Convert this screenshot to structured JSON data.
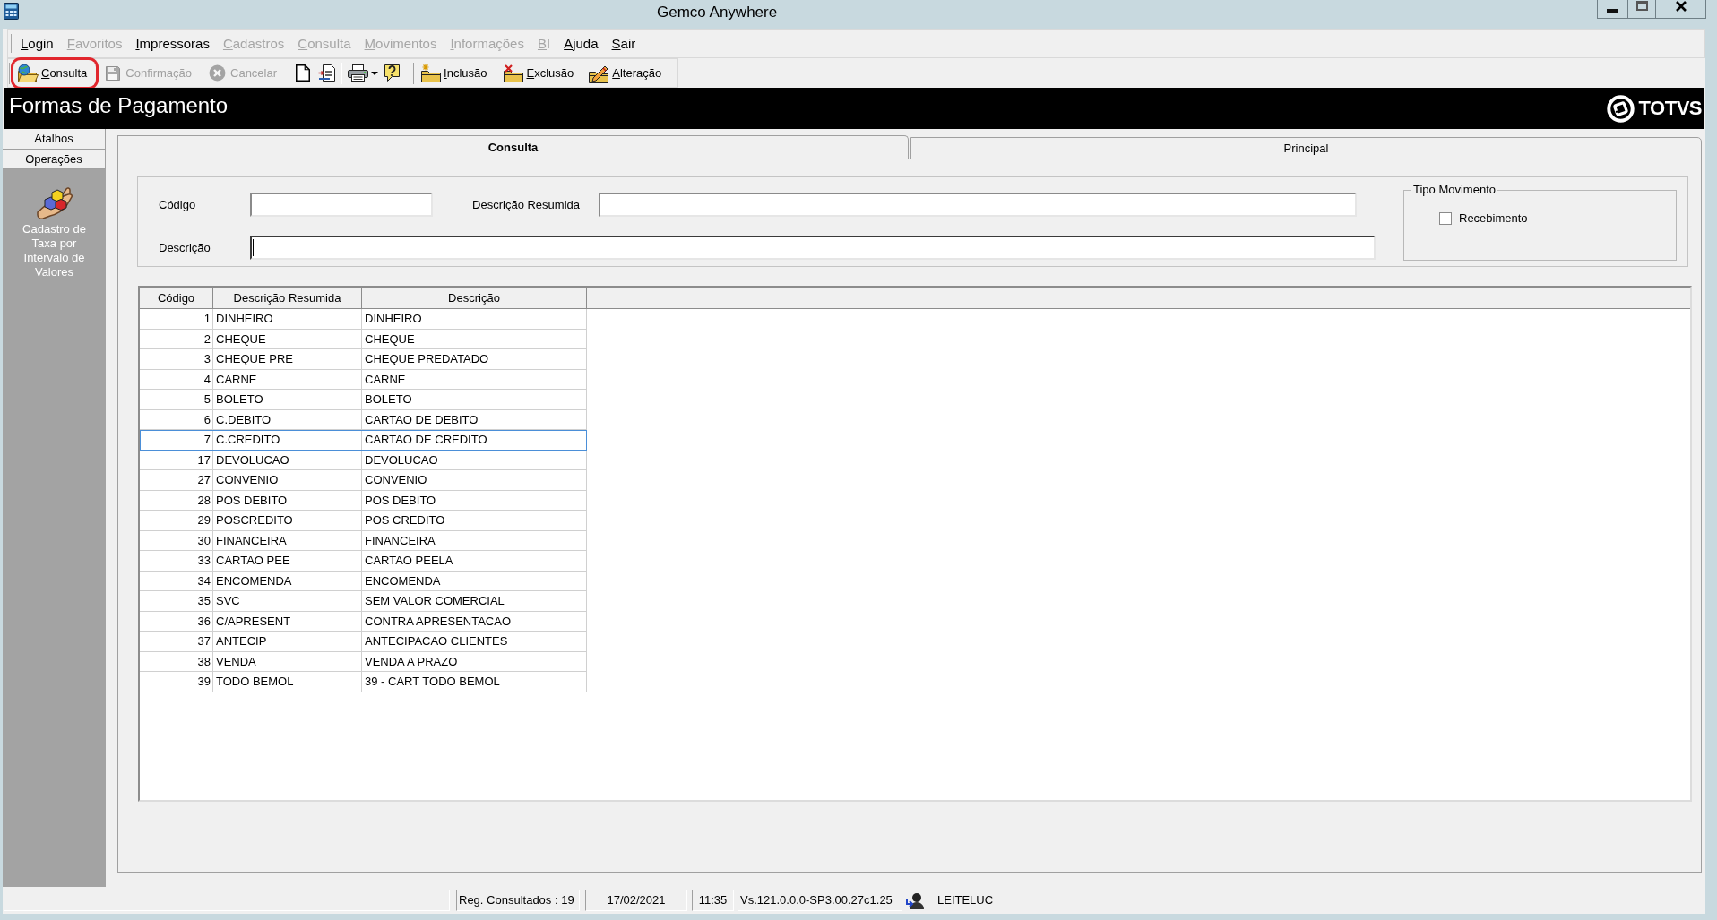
{
  "window": {
    "title": "Gemco Anywhere"
  },
  "menu": [
    {
      "label": "Login",
      "disabled": false
    },
    {
      "label": "Favoritos",
      "disabled": true
    },
    {
      "label": "Impressoras",
      "disabled": false
    },
    {
      "label": "Cadastros",
      "disabled": true
    },
    {
      "label": "Consulta",
      "disabled": true
    },
    {
      "label": "Movimentos",
      "disabled": true
    },
    {
      "label": "Informações",
      "disabled": true
    },
    {
      "label": "BI",
      "disabled": true
    },
    {
      "label": "Ajuda",
      "disabled": false
    },
    {
      "label": "Sair",
      "disabled": false
    }
  ],
  "toolbar": {
    "groups": [
      [
        {
          "kind": "button",
          "label": "Consulta",
          "disabled": false,
          "highlighted": true
        },
        {
          "kind": "button",
          "label": "Confirmação",
          "disabled": true,
          "highlighted": false
        },
        {
          "kind": "button",
          "label": "Cancelar",
          "disabled": true,
          "highlighted": false
        },
        {
          "kind": "icon",
          "disabled": false,
          "highlighted": false
        },
        {
          "kind": "icon",
          "disabled": false,
          "highlighted": false
        }
      ],
      [
        {
          "kind": "dropdown",
          "disabled": false,
          "highlighted": false
        },
        {
          "kind": "icon",
          "disabled": false,
          "highlighted": false
        }
      ],
      [
        {
          "kind": "button",
          "label": "Inclusão",
          "disabled": false,
          "highlighted": false
        },
        {
          "kind": "button",
          "label": "Exclusão",
          "disabled": false,
          "highlighted": false
        },
        {
          "kind": "button",
          "label": "Alteração",
          "disabled": false,
          "highlighted": false
        }
      ]
    ]
  },
  "header": {
    "title": "Formas de Pagamento",
    "logo": "TOTVS"
  },
  "sidebar": {
    "buttons": [
      "Atalhos",
      "Operações"
    ],
    "items": [
      "Cadastro de Taxa por Intervalo de Valores"
    ]
  },
  "tabs": [
    {
      "label": "Consulta",
      "selected": true
    },
    {
      "label": "Principal",
      "selected": false
    }
  ],
  "filter": {
    "fields": [
      {
        "label": "Código",
        "focused": false
      },
      {
        "label": "Descrição Resumida",
        "focused": false
      },
      {
        "label": "Descrição",
        "focused": true
      }
    ],
    "group": {
      "title": "Tipo Movimento",
      "options": [
        {
          "label": "Recebimento",
          "checked": false
        }
      ]
    }
  },
  "table": {
    "columns": [
      "Código",
      "Descrição Resumida",
      "Descrição"
    ],
    "rows": [
      {
        "cells": [
          "1",
          "DINHEIRO",
          "DINHEIRO"
        ],
        "selected": false
      },
      {
        "cells": [
          "2",
          "CHEQUE",
          "CHEQUE"
        ],
        "selected": false
      },
      {
        "cells": [
          "3",
          "CHEQUE PRE",
          "CHEQUE PREDATADO"
        ],
        "selected": false
      },
      {
        "cells": [
          "4",
          "CARNE",
          "CARNE"
        ],
        "selected": false
      },
      {
        "cells": [
          "5",
          "BOLETO",
          "BOLETO"
        ],
        "selected": false
      },
      {
        "cells": [
          "6",
          "C.DEBITO",
          "CARTAO DE DEBITO"
        ],
        "selected": false
      },
      {
        "cells": [
          "7",
          "C.CREDITO",
          "CARTAO DE CREDITO"
        ],
        "selected": true
      },
      {
        "cells": [
          "17",
          "DEVOLUCAO",
          "DEVOLUCAO"
        ],
        "selected": false
      },
      {
        "cells": [
          "27",
          "CONVENIO",
          "CONVENIO"
        ],
        "selected": false
      },
      {
        "cells": [
          "28",
          "POS DEBITO",
          "POS DEBITO"
        ],
        "selected": false
      },
      {
        "cells": [
          "29",
          "POSCREDITO",
          "POS CREDITO"
        ],
        "selected": false
      },
      {
        "cells": [
          "30",
          "FINANCEIRA",
          "FINANCEIRA"
        ],
        "selected": false
      },
      {
        "cells": [
          "33",
          "CARTAO PEE",
          "CARTAO PEELA"
        ],
        "selected": false
      },
      {
        "cells": [
          "34",
          "ENCOMENDA",
          "ENCOMENDA"
        ],
        "selected": false
      },
      {
        "cells": [
          "35",
          "SVC",
          "SEM VALOR COMERCIAL"
        ],
        "selected": false
      },
      {
        "cells": [
          "36",
          "C/APRESENT",
          "CONTRA APRESENTACAO"
        ],
        "selected": false
      },
      {
        "cells": [
          "37",
          "ANTECIP",
          "ANTECIPACAO CLIENTES"
        ],
        "selected": false
      },
      {
        "cells": [
          "38",
          "VENDA",
          "VENDA A PRAZO"
        ],
        "selected": false
      },
      {
        "cells": [
          "39",
          "TODO BEMOL",
          "39 - CART TODO BEMOL"
        ],
        "selected": false
      }
    ]
  },
  "status_bar": {
    "panels": [
      "Reg. Consultados : 19",
      "17/02/2021",
      "11:35",
      "Vs.121.0.0.0-SP3.00.27c1.25"
    ],
    "user": "LEITELUC"
  }
}
